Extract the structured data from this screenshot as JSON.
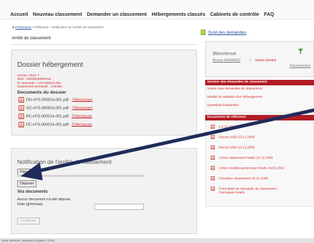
{
  "nav": {
    "items": [
      "Accueil",
      "Nouveau classement",
      "Demander un classement",
      "Hébergements classés",
      "Cabinets de contrôle",
      "FAQ"
    ]
  },
  "breadcrumb": {
    "home_icon": "home-icon",
    "link": "Préfectures",
    "rest": " / Préfecture - Notification de l'arrêté de classement"
  },
  "page_title": "Arrêté de classement",
  "dossier": {
    "title": "Dossier hébergement",
    "lines": [
      "HOTEL TEST 7",
      "Siret : 34000645500015",
      "N° demande : H75-000014-001",
      "Classement demandé : 3 étoiles"
    ],
    "docs_heading": "Documents du dossier",
    "docs": [
      {
        "file": "DG-H75-000014-001.pdf - ",
        "link": "Télécharger"
      },
      {
        "file": "GC-H75-000014-001.pdf - ",
        "link": "Télécharger"
      },
      {
        "file": "RC-H75-000014-001.pdf - ",
        "link": "Télécharger"
      },
      {
        "file": "DC-H75-000014-001.pdf - ",
        "link": "Télécharger"
      }
    ]
  },
  "notification": {
    "title": "Notification de l'arrêté de classement",
    "browse_label": "Parcourir...",
    "deposit_label": "Déposer",
    "vos_docs": "Vos documents",
    "none_text": "Aucun document n'a été déposé",
    "date_label": "Date (jj/mm/aa)",
    "date_value": "",
    "confirm_label": "Confirmer"
  },
  "sidebar": {
    "suivi_link": "Suivi des demandes",
    "welcome": "Bienvenue",
    "user_name": "Bruno HERARD",
    "separator": "|",
    "user_short": "bruno.herard",
    "logout": "Déconnexion",
    "gestion_header": "Gestion des demandes de classement",
    "gestion_links": [
      "Suivre mes demandes de classement",
      "Notifier la radiation d'un hébergement",
      "Questions fréquentes"
    ],
    "refs_header": "Documents de référence",
    "refs": [
      "Loi 22 07 2009",
      "Decret 1650-23.12.2009",
      "Decret 1652-23.12.2009",
      "Arrete classement hotels 23.12.2009",
      "Arrete modele panonceau hotels 19.02.2010",
      "Circulaire classement 29.12.2009",
      "Formulaire de demande de classement - Hotellerie"
    ],
    "refs_extra": [
      "Formulaire de demande de classement -",
      "Formulaire hotels"
    ]
  },
  "footer": "Liens internes | Mentions légales | CGU"
}
